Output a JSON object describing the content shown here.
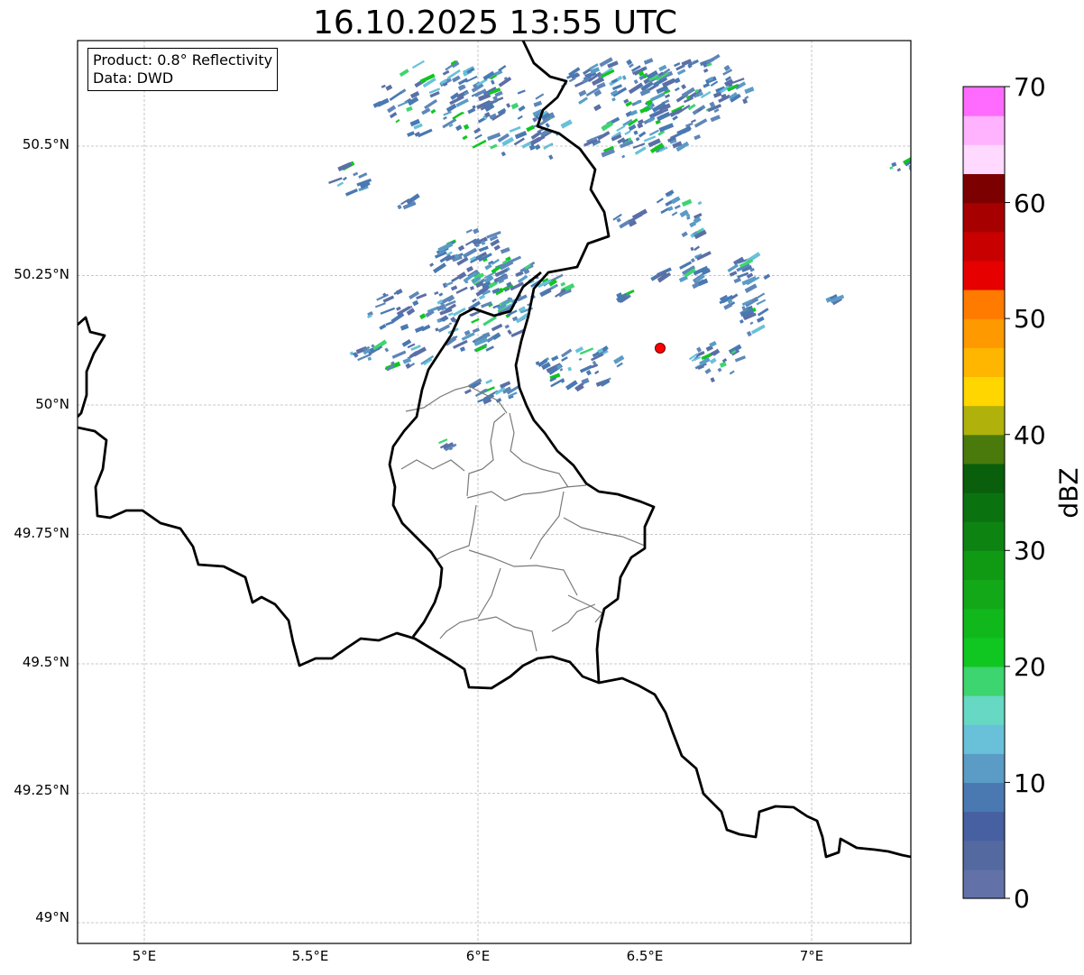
{
  "title": "16.10.2025 13:55 UTC",
  "info_box": {
    "product": "Product: 0.8° Reflectivity",
    "data": "Data: DWD"
  },
  "axes": {
    "lon_range": [
      4.8,
      7.3
    ],
    "lat_range": [
      48.95,
      50.7
    ],
    "x_ticks": [
      "5°E",
      "5.5°E",
      "6°E",
      "6.5°E",
      "7°E"
    ],
    "y_ticks": [
      "50.5°N",
      "50.25°N",
      "50°N",
      "49.75°N",
      "49.5°N",
      "49.25°N",
      "49°N"
    ],
    "grid": true
  },
  "radar_site": {
    "lon": 6.55,
    "lat": 50.11,
    "color": "#ff0000"
  },
  "colorbar": {
    "label": "dBZ",
    "range": [
      0,
      70
    ],
    "tick_labels": [
      "0",
      "10",
      "20",
      "30",
      "40",
      "50",
      "60",
      "70"
    ],
    "colors": [
      "#6271a8",
      "#5369a0",
      "#4660a1",
      "#4a79b2",
      "#5a9cc6",
      "#68c1d9",
      "#66d8c4",
      "#3dd56f",
      "#10c620",
      "#10b81c",
      "#12a818",
      "#109a14",
      "#0d8412",
      "#0b7210",
      "#095f0b",
      "#4a7a0c",
      "#b0b20b",
      "#ffd600",
      "#ffb600",
      "#ff9900",
      "#ff7b00",
      "#e60000",
      "#c80000",
      "#a60000",
      "#7d0000",
      "#ffd9ff",
      "#ffb3ff",
      "#ff6bff",
      "#ef33ef"
    ]
  }
}
